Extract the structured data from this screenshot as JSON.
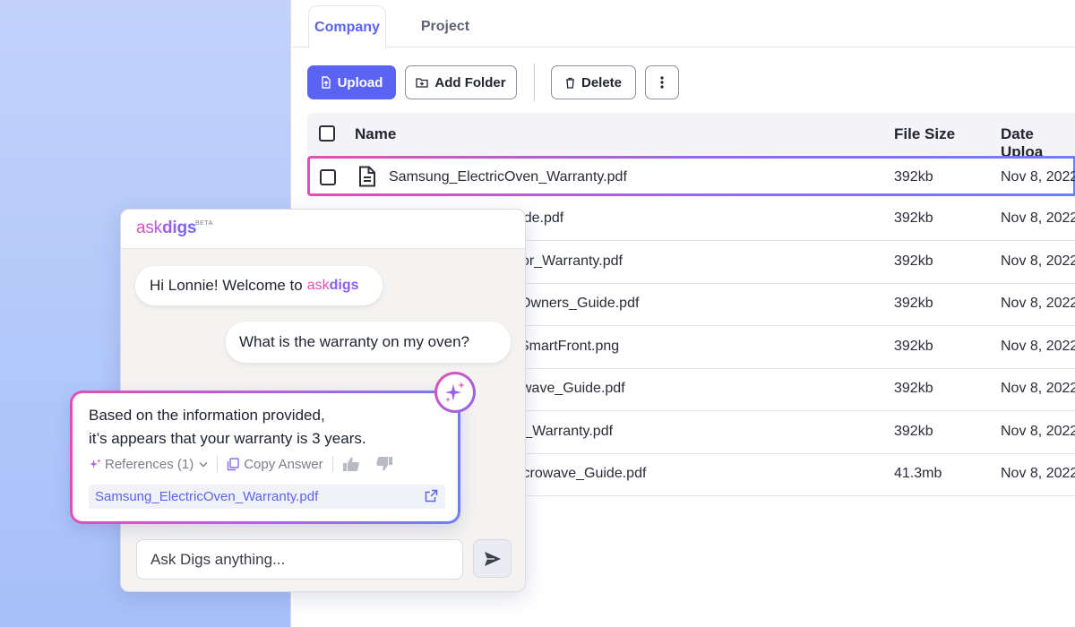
{
  "tabs": [
    {
      "label": "Company",
      "active": true
    },
    {
      "label": "Project",
      "active": false
    }
  ],
  "toolbar": {
    "upload_label": "Upload",
    "add_folder_label": "Add Folder",
    "delete_label": "Delete"
  },
  "table": {
    "columns": [
      "Name",
      "File Size",
      "Date Uploa"
    ],
    "rows": [
      {
        "name": "Samsung_ElectricOven_Warranty.pdf",
        "size": "392kb",
        "date": "Nov 8, 2022"
      },
      {
        "name": "e_Guide.pdf",
        "size": "392kb",
        "date": "Nov 8, 2022"
      },
      {
        "name": "or_Warranty.pdf",
        "size": "392kb",
        "date": "Nov 8, 2022"
      },
      {
        "name": "Owners_Guide.pdf",
        "size": "392kb",
        "date": "Nov 8, 2022"
      },
      {
        "name": "SmartFront.png",
        "size": "392kb",
        "date": "Nov 8, 2022"
      },
      {
        "name": "wave_Guide.pdf",
        "size": "392kb",
        "date": "Nov 8, 2022"
      },
      {
        "name": "r_Warranty.pdf",
        "size": "392kb",
        "date": "Nov 8, 2022"
      },
      {
        "name": "icrowave_Guide.pdf",
        "size": "41.3mb",
        "date": "Nov 8, 2022"
      }
    ]
  },
  "chat": {
    "brand_ask": "ask",
    "brand_digs": "digs",
    "brand_beta": "BETA",
    "welcome_text": "Hi Lonnie! Welcome to",
    "user_question": "What is the warranty on my oven?",
    "answer_line1": "Based on the information provided,",
    "answer_line2": "it’s appears that your warranty is 3 years.",
    "references_label": "References (1)",
    "copy_label": "Copy Answer",
    "reference_file": "Samsung_ElectricOven_Warranty.pdf",
    "input_placeholder": "Ask Digs anything..."
  },
  "colors": {
    "accent": "#5b63f5",
    "gradient_pink": "#e24fb4",
    "gradient_violet": "#8c6bf0",
    "background_blue": "#b3c8fa"
  },
  "icons": [
    "upload-icon",
    "folder-plus-icon",
    "trash-icon",
    "more-vertical-icon",
    "document-icon",
    "sparkle-icon",
    "chevron-down-icon",
    "copy-icon",
    "thumbs-up-icon",
    "thumbs-down-icon",
    "external-link-icon",
    "send-icon"
  ]
}
